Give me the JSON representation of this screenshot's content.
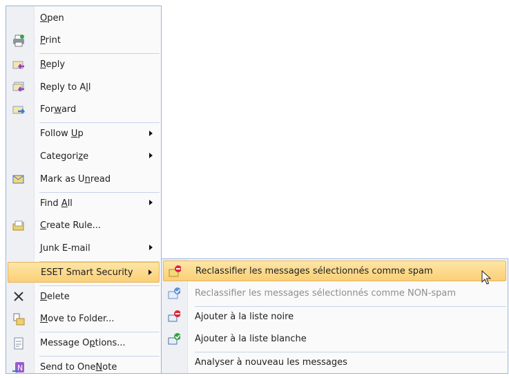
{
  "main_menu": {
    "items": [
      {
        "name": "open",
        "parts": [
          "",
          "O",
          "pen"
        ],
        "icon": "none"
      },
      {
        "name": "print",
        "parts": [
          "",
          "P",
          "rint"
        ],
        "icon": "printer-icon"
      },
      {
        "sep": true
      },
      {
        "name": "reply",
        "parts": [
          "",
          "R",
          "eply"
        ],
        "icon": "reply-icon"
      },
      {
        "name": "reply-to-all",
        "parts": [
          "Reply to A",
          "l",
          "l"
        ],
        "icon": "reply-all-icon"
      },
      {
        "name": "forward",
        "parts": [
          "For",
          "w",
          "ard"
        ],
        "icon": "forward-icon"
      },
      {
        "sep": true
      },
      {
        "name": "follow-up",
        "parts": [
          "Follow ",
          "U",
          "p"
        ],
        "icon": "none",
        "submenu": true
      },
      {
        "name": "categorize",
        "parts": [
          "Categori",
          "z",
          "e"
        ],
        "icon": "none",
        "submenu": true
      },
      {
        "name": "mark-as-unread",
        "parts": [
          "Mark as U",
          "n",
          "read"
        ],
        "icon": "mark-unread-icon"
      },
      {
        "sep": true
      },
      {
        "name": "find-all",
        "parts": [
          "Find ",
          "A",
          "ll"
        ],
        "icon": "none",
        "submenu": true
      },
      {
        "name": "create-rule",
        "parts": [
          "",
          "C",
          "reate Rule..."
        ],
        "icon": "create-rule-icon"
      },
      {
        "name": "junk-email",
        "parts": [
          "",
          "J",
          "unk E-mail"
        ],
        "icon": "none",
        "submenu": true
      },
      {
        "sep": true
      },
      {
        "name": "eset-smart-security",
        "parts": [
          "ESET Smart Security",
          "",
          ""
        ],
        "icon": "none",
        "submenu": true,
        "highlighted": true
      },
      {
        "sep": true
      },
      {
        "name": "delete",
        "parts": [
          "",
          "D",
          "elete"
        ],
        "icon": "delete-icon"
      },
      {
        "name": "move-to-folder",
        "parts": [
          "",
          "M",
          "ove to Folder..."
        ],
        "icon": "move-folder-icon"
      },
      {
        "sep": true
      },
      {
        "name": "message-options",
        "parts": [
          "Message O",
          "p",
          "tions..."
        ],
        "icon": "message-options-icon"
      },
      {
        "sep": true
      },
      {
        "name": "send-to-onenote",
        "parts": [
          "Send to One",
          "N",
          "ote"
        ],
        "icon": "onenote-icon"
      }
    ]
  },
  "eset_submenu": {
    "items": [
      {
        "name": "reclassify-spam",
        "parts": [
          "Reclassifier les messages sélectionnés comme spam",
          "",
          ""
        ],
        "icon": "spam-envelope-icon",
        "highlighted": true
      },
      {
        "name": "reclassify-non-spam",
        "parts": [
          "Reclassifier les messages sélectionnés comme NON-spam",
          "",
          ""
        ],
        "icon": "non-spam-envelope-icon",
        "disabled": true
      },
      {
        "sep": true
      },
      {
        "name": "add-blacklist",
        "parts": [
          "Ajouter à la liste noire",
          "",
          ""
        ],
        "icon": "blacklist-icon"
      },
      {
        "name": "add-whitelist",
        "parts": [
          "Ajouter à la liste blanche",
          "",
          ""
        ],
        "icon": "whitelist-icon"
      },
      {
        "sep": true
      },
      {
        "name": "rescan-messages",
        "parts": [
          "Analyser à nouveau les messages",
          "",
          ""
        ],
        "icon": "none"
      }
    ]
  },
  "colors": {
    "highlight": "#fbcf77",
    "border": "#9bb3dc",
    "separator": "#c5d3ec"
  }
}
